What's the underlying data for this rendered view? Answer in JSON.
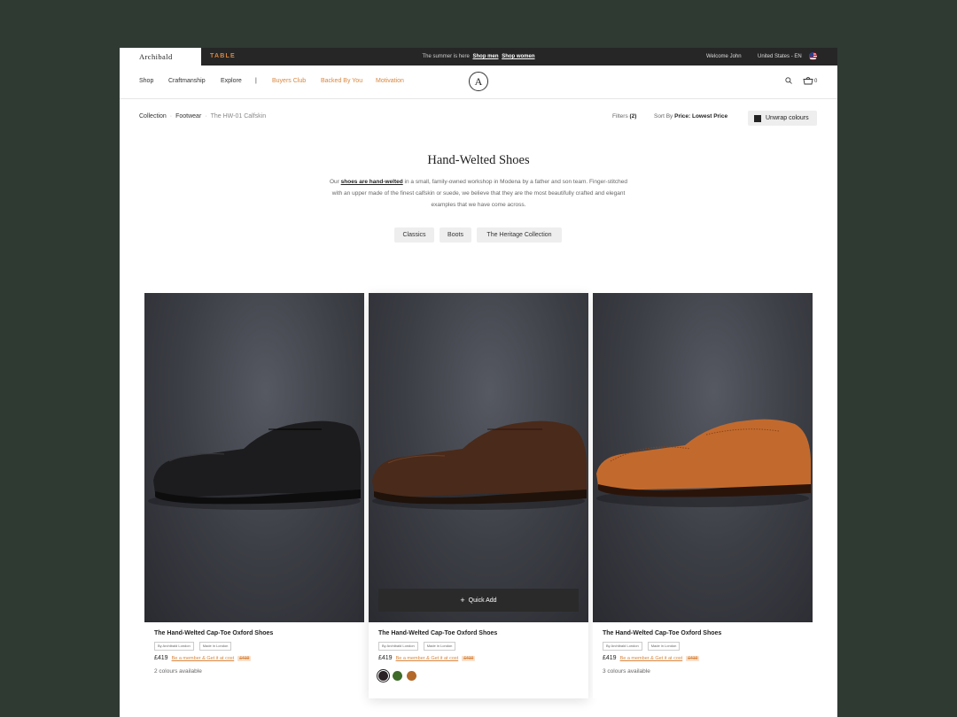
{
  "topbar": {
    "brand": "Archibald",
    "brand_sub": "TABLE",
    "promo_text": "The summer is here",
    "promo_link_men": "Shop men",
    "promo_link_women": "Shop women",
    "welcome": "Welcome John",
    "region": "United States - EN"
  },
  "nav": {
    "items": [
      "Shop",
      "Craftmanship",
      "Explore"
    ],
    "separator": "|",
    "accent_items": [
      "Buyers Club",
      "Backed By You",
      "Motivation"
    ],
    "logo_letter": "A",
    "cart_count": "0"
  },
  "breadcrumb": {
    "items": [
      "Collection",
      "Footwear",
      "The HW-01 Calfskin"
    ]
  },
  "toolbar": {
    "filters_label": "Filters",
    "filters_count": "(2)",
    "sort_label": "Sort By",
    "sort_value": "Price: Lowest Price",
    "unwrap_label": "Unwrap colours"
  },
  "hero": {
    "title": "Hand-Welted Shoes",
    "desc_prefix": "Our",
    "desc_link": "shoes are hand-welted",
    "desc_rest": "in a small, family-owned workshop in Modena by a father and son team. Finger-stitched with an upper made of the finest calfskin or suede, we believe that they are the most beautifully crafted and elegant examples that we have come across."
  },
  "chips": [
    "Classics",
    "Boots",
    "The Heritage Collection"
  ],
  "products": [
    {
      "name": "The Hand-Welted Cap-Toe Oxford Shoes",
      "badges": [
        "By Archibald London",
        "Made in London"
      ],
      "price": "£419",
      "member_text": "Be a member & Get it at cost",
      "member_price": "£419",
      "colours_text": "2 colours available",
      "shoe_color": "#1c1c1e"
    },
    {
      "name": "The Hand-Welted Cap-Toe Oxford Shoes",
      "badges": [
        "By Archibald London",
        "Made in London"
      ],
      "price": "£419",
      "member_text": "Be a member & Get it at cost",
      "member_price": "£419",
      "quick_add": "Quick Add",
      "swatches": [
        "#2a2224",
        "#3e6b2a",
        "#b3692a"
      ],
      "shoe_color": "#4a2a1a"
    },
    {
      "name": "The Hand-Welted Cap-Toe Oxford Shoes",
      "badges": [
        "By Archibald London",
        "Made in London"
      ],
      "price": "£419",
      "member_text": "Be a member & Get it at cost",
      "member_price": "£419",
      "colours_text": "3 colours available",
      "shoe_color": "#c26a2e"
    }
  ],
  "colors": {
    "accent": "#d9863e",
    "topbar_bg": "#262626",
    "backdrop": "#2f3a33"
  }
}
